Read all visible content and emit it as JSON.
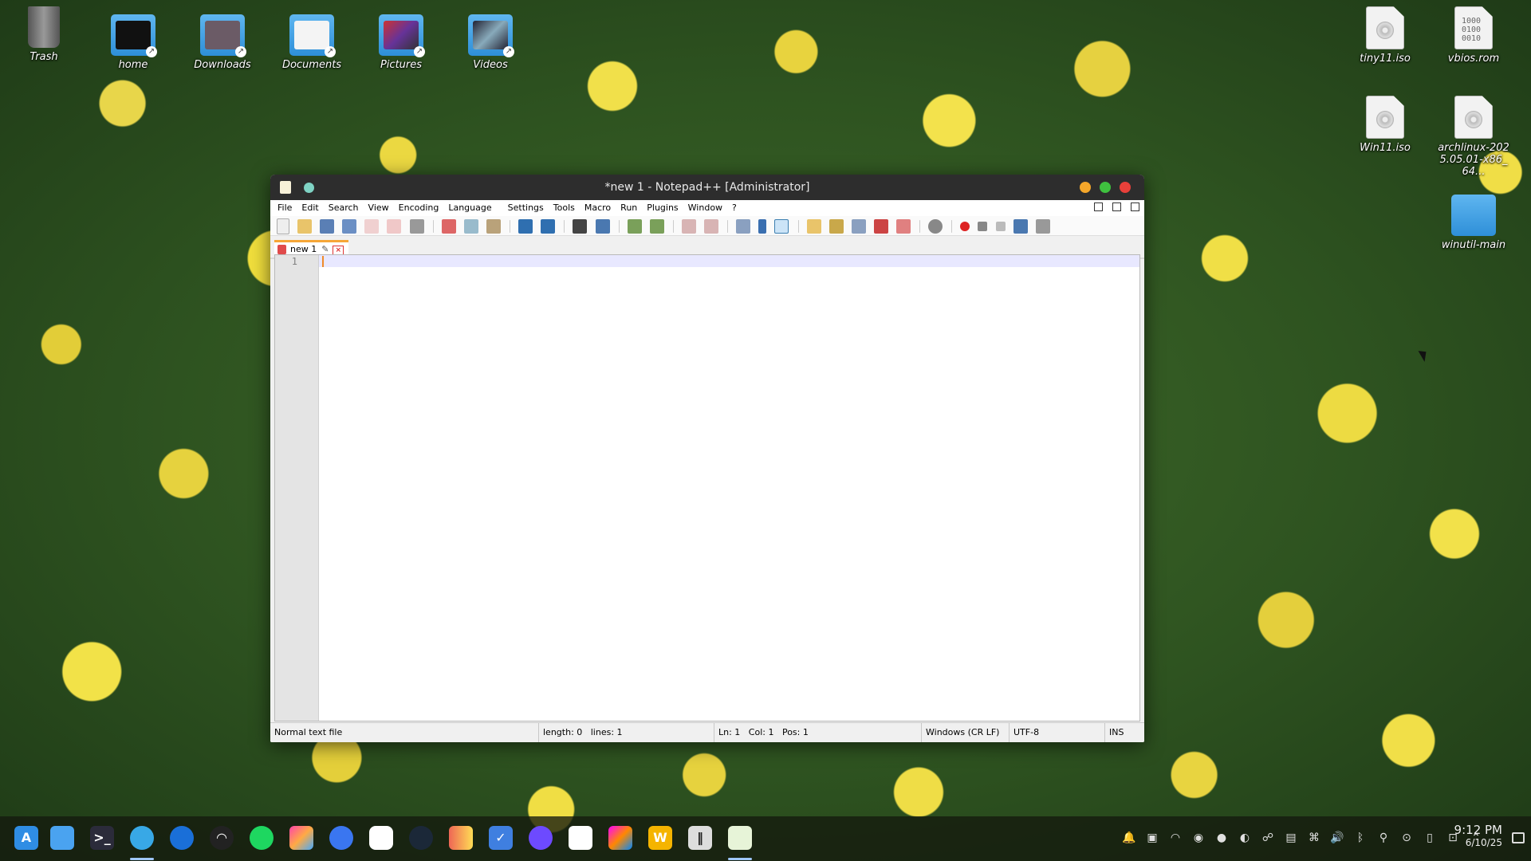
{
  "desktop": {
    "left_icons": [
      {
        "label": "Trash",
        "icon": "trash-icon"
      },
      {
        "label": "home",
        "icon": "home-folder-icon"
      },
      {
        "label": "Downloads",
        "icon": "downloads-folder-icon"
      },
      {
        "label": "Documents",
        "icon": "documents-folder-icon"
      },
      {
        "label": "Pictures",
        "icon": "pictures-folder-icon"
      },
      {
        "label": "Videos",
        "icon": "videos-folder-icon"
      }
    ],
    "right_icons": [
      {
        "label": "tiny11.iso",
        "icon": "disc-image-icon"
      },
      {
        "label": "vbios.rom",
        "icon": "binary-file-icon",
        "content": "1000\n0100\n0010"
      },
      {
        "label": "Win11.iso",
        "icon": "disc-image-icon"
      },
      {
        "label": "archlinux-2025.05.01-x86_64...",
        "icon": "disc-image-icon"
      },
      {
        "label": "winutil-main",
        "icon": "folder-icon"
      }
    ]
  },
  "window": {
    "title": "*new 1 - Notepad++ [Administrator]",
    "menu": [
      "File",
      "Edit",
      "Search",
      "View",
      "Encoding",
      "Language",
      "Settings",
      "Tools",
      "Macro",
      "Run",
      "Plugins",
      "Window",
      "?"
    ],
    "tab": {
      "label": "new 1"
    },
    "editor": {
      "line_numbers": [
        "1"
      ],
      "content": ""
    },
    "status": {
      "file_type": "Normal text file",
      "length_lines": "length: 0   lines: 1",
      "position": "Ln: 1   Col: 1   Pos: 1",
      "eol": "Windows (CR LF)",
      "encoding": "UTF-8",
      "mode": "INS"
    }
  },
  "taskbar": {
    "apps": [
      "app-store-icon",
      "files-icon",
      "terminal-icon",
      "browser-icon",
      "thunderbird-icon",
      "zen-icon",
      "spotify-icon",
      "photos-icon",
      "signal-icon",
      "chromium-icon",
      "steam-icon",
      "office-icon",
      "tasks-icon",
      "proton-icon",
      "vscode-icon",
      "jetbrains-icon",
      "wps-icon",
      "heroic-icon",
      "notepadpp-icon"
    ],
    "clock_time": "9:12 PM",
    "clock_date": "6/10/25"
  },
  "colors": {
    "accent_tab": "#f6a637",
    "titlebar": "#2d2d2d",
    "close": "#e8403a",
    "minimize": "#f4a62a",
    "maximize": "#3fc13f"
  }
}
